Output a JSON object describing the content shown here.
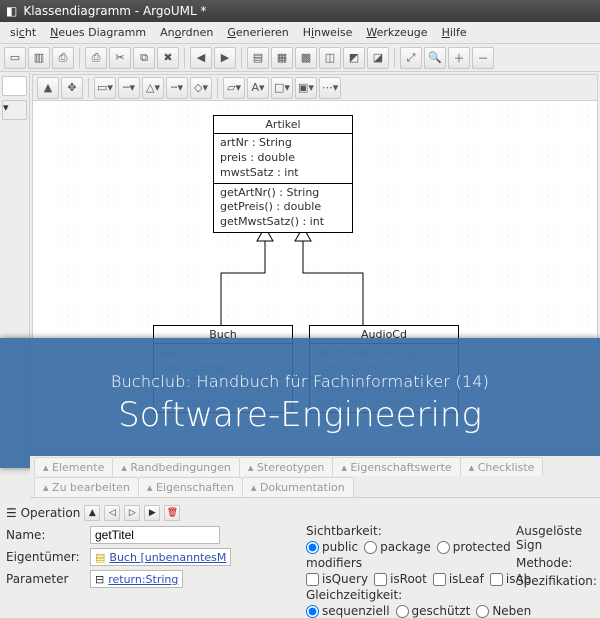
{
  "window": {
    "title": "Klassendiagramm - ArgoUML *"
  },
  "menu": [
    "sicht",
    "Neues Diagramm",
    "Anordnen",
    "Generieren",
    "Hinweise",
    "Werkzeuge",
    "Hilfe"
  ],
  "menu_underline_idx": [
    0,
    0,
    1,
    0,
    2,
    0,
    0
  ],
  "overlay": {
    "subtitle": "Buchclub: Handbuch für Fachinformatiker (14)",
    "title": "Software-Engineering"
  },
  "uml": {
    "artikel": {
      "name": "Artikel",
      "attrs": [
        "artNr : String",
        "preis : double",
        "mwstSatz : int"
      ],
      "ops": [
        "getArtNr() : String",
        "getPreis() : double",
        "getMwstSatz() : int"
      ]
    },
    "buch": {
      "name": "Buch",
      "attrs": [
        "auto : String",
        "titel : String"
      ],
      "ops": [
        "getAutor() : String",
        "getTitel() : String"
      ]
    },
    "audiocd": {
      "name": "AudioCd",
      "attrs": [
        "interprete : String",
        "titel : String"
      ],
      "ops": [
        "getInterprete() : String",
        "getTitel() : String"
      ]
    }
  },
  "tabs_upper": [
    "Elemente",
    "Randbedingungen",
    "Stereotypen",
    "Eigenschaftswerte",
    "Checkliste"
  ],
  "tabs_lower": [
    "Zu bearbeiten",
    "Eigenschaften",
    "Dokumentation"
  ],
  "props": {
    "operation_label": "Operation",
    "name_label": "Name:",
    "name_value": "getTitel",
    "owner_label": "Eigentümer:",
    "owner_value": "Buch  [unbenanntesM",
    "param_label": "Parameter",
    "param_value": "return:String",
    "visibility_label": "Sichtbarkeit:",
    "visibility_options": [
      "public",
      "package",
      "protected"
    ],
    "visibility_selected": "public",
    "modifiers_label": "modifiers",
    "modifier_options": [
      "isQuery",
      "isRoot",
      "isLeaf",
      "isAb"
    ],
    "concurrency_label": "Gleichzeitigkeit:",
    "concurrency_options": [
      "sequenziell",
      "geschützt",
      "Neben"
    ],
    "concurrency_selected": "sequenziell",
    "right_labels": [
      "Ausgelöste Sign",
      "Methode:",
      "Spezifikation:"
    ]
  }
}
